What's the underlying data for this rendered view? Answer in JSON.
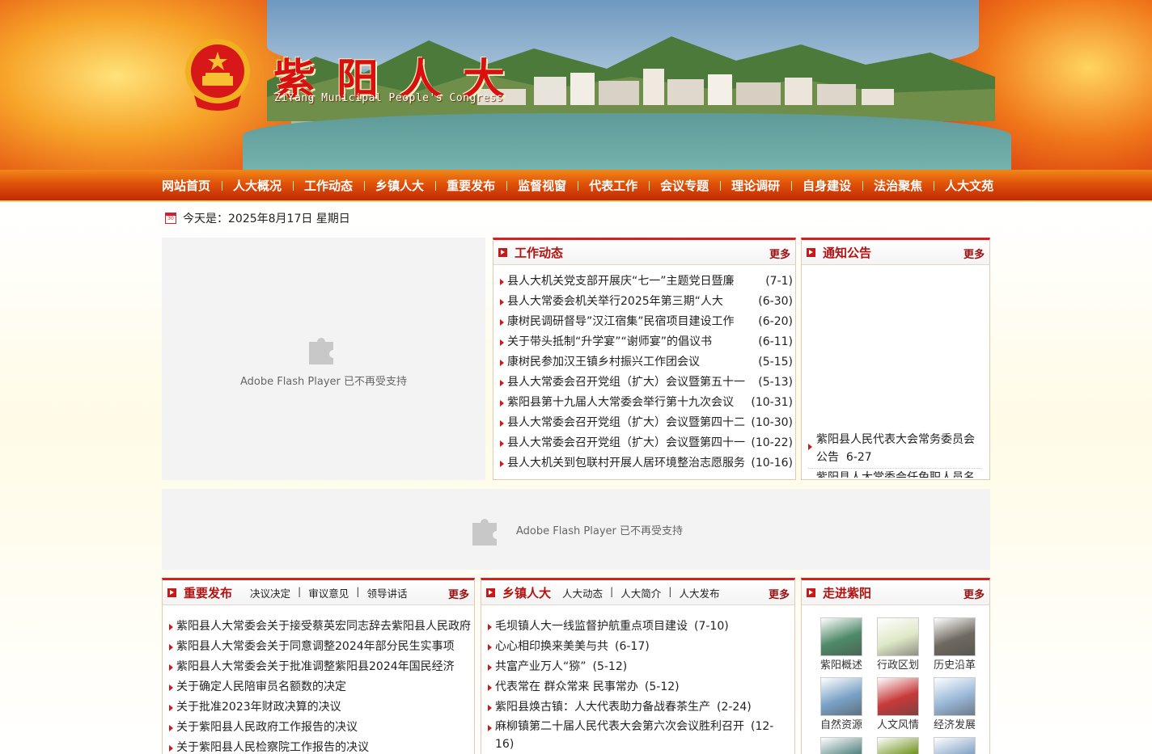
{
  "site": {
    "title": "紫阳人大",
    "subtitle": "ZiYang Municipal People's Congress"
  },
  "nav": {
    "items": [
      "网站首页",
      "人大概况",
      "工作动态",
      "乡镇人大",
      "重要发布",
      "监督视窗",
      "代表工作",
      "会议专题",
      "理论调研",
      "自身建设",
      "法治聚焦",
      "人大文苑"
    ]
  },
  "date_text": "今天是：2025年8月17日 星期日",
  "calendar_icon_text": "30",
  "flash_message": "Adobe Flash Player 已不再受支持",
  "work_news": {
    "title": "工作动态",
    "more": "更多",
    "items": [
      {
        "text": "县人大机关党支部开展庆“七一”主题党日暨廉",
        "date": "(7-1)"
      },
      {
        "text": "县人大常委会机关举行2025年第三期“人大",
        "date": "(6-30)"
      },
      {
        "text": "康树民调研督导”汉江宿集”民宿项目建设工作",
        "date": "(6-20)"
      },
      {
        "text": "关于带头抵制“升学宴”“谢师宴”的倡议书",
        "date": "(6-11)"
      },
      {
        "text": "康树民参加汉王镇乡村振兴工作团会议",
        "date": "(5-15)"
      },
      {
        "text": "县人大常委会召开党组（扩大）会议暨第五十一",
        "date": "(5-13)"
      },
      {
        "text": "紫阳县第十九届人大常委会举行第十九次会议",
        "date": "(10-31)"
      },
      {
        "text": "县人大常委会召开党组（扩大）会议暨第四十二",
        "date": "(10-30)"
      },
      {
        "text": "县人大常委会召开党组（扩大）会议暨第四十一",
        "date": "(10-22)"
      },
      {
        "text": "县人大机关到包联村开展人居环境整治志愿服务",
        "date": "(10-16)"
      }
    ]
  },
  "notice": {
    "title": "通知公告",
    "more": "更多",
    "items": [
      {
        "text": "紫阳县人民代表大会常务委员会公告",
        "date": "6-27"
      },
      {
        "text": "紫阳县人大常委会任免职人员名",
        "date": ""
      }
    ]
  },
  "releases": {
    "title": "重要发布",
    "more": "更多",
    "subtabs": [
      "决议决定",
      "审议意见",
      "领导讲话"
    ],
    "items": [
      "紫阳县人大常委会关于接受蔡英宏同志辞去紫阳县人民政府",
      "紫阳县人大常委会关于同意调整2024年部分民生实事项",
      "紫阳县人大常委会关于批准调整紫阳县2024年国民经济",
      "关于确定人民陪审员名额数的决定",
      "关于批准2023年财政决算的决议",
      "关于紫阳县人民政府工作报告的决议",
      "关于紫阳县人民检察院工作报告的决议"
    ]
  },
  "township": {
    "title": "乡镇人大",
    "more": "更多",
    "subtabs": [
      "人大动态",
      "人大简介",
      "人大发布"
    ],
    "items": [
      {
        "text": "毛坝镇人大一线监督护航重点项目建设",
        "date": "(7-10)"
      },
      {
        "text": "心心相印换来美美与共",
        "date": "(6-17)"
      },
      {
        "text": "共富产业万人“猕”",
        "date": "(5-12)"
      },
      {
        "text": "代表常在 群众常来 民事常办",
        "date": "(5-12)"
      },
      {
        "text": "紫阳县焕古镇：人大代表助力备战春茶生产",
        "date": "(2-24)"
      },
      {
        "text": "麻柳镇第二十届人民代表大会第六次会议胜利召开",
        "date": "(12-16)"
      }
    ]
  },
  "ziyang": {
    "title": "走进紫阳",
    "more": "更多",
    "thumbs": [
      {
        "caption": "紫阳概述",
        "color": "#4f8a6a"
      },
      {
        "caption": "行政区划",
        "color": "#dfe8c8"
      },
      {
        "caption": "历史沿革",
        "color": "#6f6a60"
      },
      {
        "caption": "自然资源",
        "color": "#7aa2c6"
      },
      {
        "caption": "人文风情",
        "color": "#c83a3a"
      },
      {
        "caption": "经济发展",
        "color": "#9ab8d8"
      },
      {
        "caption": "",
        "color": "#5d8a86"
      },
      {
        "caption": "",
        "color": "#7a9a2a"
      },
      {
        "caption": "",
        "color": "#8aa8c8"
      }
    ]
  },
  "colors": {
    "accent": "#d42020",
    "nav_top": "#f08818",
    "nav_bottom": "#c02a04"
  }
}
